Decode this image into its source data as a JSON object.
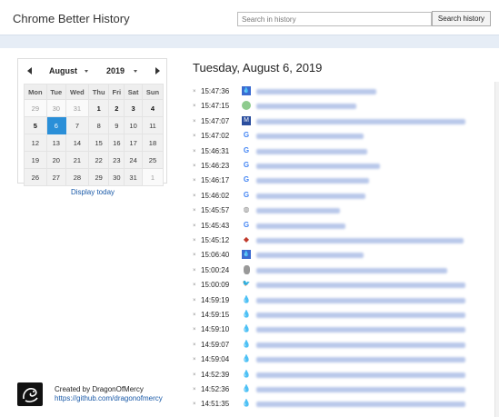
{
  "app": {
    "title": "Chrome Better History"
  },
  "search": {
    "placeholder": "Search in history",
    "button": "Search history"
  },
  "calendar": {
    "month": "August",
    "year": "2019",
    "weekdays": [
      "Mon",
      "Tue",
      "Wed",
      "Thu",
      "Fri",
      "Sat",
      "Sun"
    ],
    "weeks": [
      [
        "29",
        "30",
        "31",
        "1",
        "2",
        "3",
        "4"
      ],
      [
        "5",
        "6",
        "7",
        "8",
        "9",
        "10",
        "11"
      ],
      [
        "12",
        "13",
        "14",
        "15",
        "16",
        "17",
        "18"
      ],
      [
        "19",
        "20",
        "21",
        "22",
        "23",
        "24",
        "25"
      ],
      [
        "26",
        "27",
        "28",
        "29",
        "30",
        "31",
        "1"
      ]
    ],
    "selected_day": "6",
    "display_today": "Display today"
  },
  "credit": {
    "text": "Created by DragonOfMercy",
    "link": "https://github.com/dragonofmercy"
  },
  "history": {
    "date": "Tuesday, August 6, 2019",
    "entries": [
      {
        "time": "15:47:36",
        "icon": "water-drop-blue-square-icon",
        "color": "#3b6bd1"
      },
      {
        "time": "15:47:15",
        "icon": "green-circle-icon",
        "color": "#8ecb8e"
      },
      {
        "time": "15:47:07",
        "icon": "mi-square-icon",
        "color": "#2b4e9e"
      },
      {
        "time": "15:47:02",
        "icon": "google-g-icon",
        "color": "#4285f4"
      },
      {
        "time": "15:46:31",
        "icon": "google-g-icon",
        "color": "#4285f4"
      },
      {
        "time": "15:46:23",
        "icon": "google-g-icon",
        "color": "#4285f4"
      },
      {
        "time": "15:46:17",
        "icon": "google-g-icon",
        "color": "#4285f4"
      },
      {
        "time": "15:46:02",
        "icon": "google-g-icon",
        "color": "#4285f4"
      },
      {
        "time": "15:45:57",
        "icon": "globe-icon",
        "color": "#888888"
      },
      {
        "time": "15:45:43",
        "icon": "google-g-icon",
        "color": "#4285f4"
      },
      {
        "time": "15:45:12",
        "icon": "diamond-logo-icon",
        "color": "#c0392b"
      },
      {
        "time": "15:06:40",
        "icon": "water-drop-blue-square-icon",
        "color": "#3b6bd1"
      },
      {
        "time": "15:00:24",
        "icon": "gray-blob-icon",
        "color": "#999999"
      },
      {
        "time": "15:00:09",
        "icon": "twitter-bird-icon",
        "color": "#1da1f2"
      },
      {
        "time": "14:59:19",
        "icon": "water-drop-icon",
        "color": "#5b8fd8"
      },
      {
        "time": "14:59:15",
        "icon": "water-drop-icon",
        "color": "#5b8fd8"
      },
      {
        "time": "14:59:10",
        "icon": "water-drop-icon",
        "color": "#5b8fd8"
      },
      {
        "time": "14:59:07",
        "icon": "water-drop-icon",
        "color": "#5b8fd8"
      },
      {
        "time": "14:59:04",
        "icon": "water-drop-icon",
        "color": "#5b8fd8"
      },
      {
        "time": "14:52:39",
        "icon": "water-drop-icon",
        "color": "#5b8fd8"
      },
      {
        "time": "14:52:36",
        "icon": "water-drop-icon",
        "color": "#5b8fd8"
      },
      {
        "time": "14:51:35",
        "icon": "water-drop-icon",
        "color": "#5b8fd8"
      }
    ]
  }
}
